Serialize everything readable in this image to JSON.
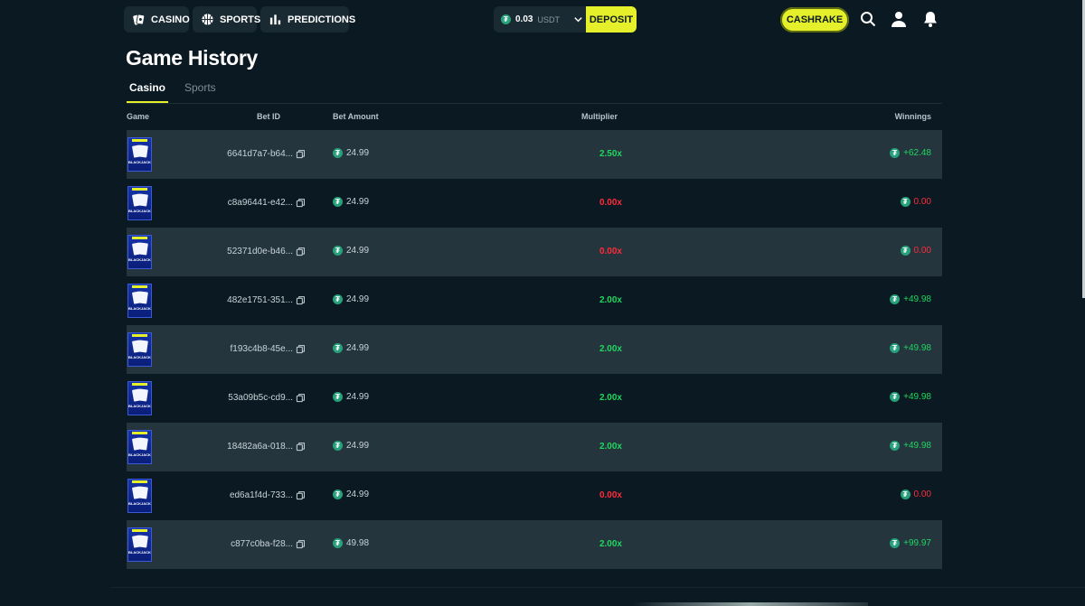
{
  "nav": {
    "casino": "CASINO",
    "sports": "SPORTS",
    "predictions": "PREDICTIONS"
  },
  "wallet": {
    "amount": "0.03",
    "currency": "USDT",
    "deposit": "DEPOSIT"
  },
  "cashrake": "CASHRAKE",
  "page": {
    "title": "Game History",
    "tabs": [
      "Casino",
      "Sports"
    ]
  },
  "table": {
    "headers": {
      "game": "Game",
      "bet_id": "Bet ID",
      "bet_amount": "Bet Amount",
      "multiplier": "Multiplier",
      "winnings": "Winnings"
    },
    "game_name": "BLACKJACK",
    "rows": [
      {
        "bet_id": "6641d7a7-b64...",
        "amount": "24.99",
        "multiplier": "2.50x",
        "winnings": "+62.48",
        "result": "win"
      },
      {
        "bet_id": "c8a96441-e42...",
        "amount": "24.99",
        "multiplier": "0.00x",
        "winnings": "0.00",
        "result": "loss"
      },
      {
        "bet_id": "52371d0e-b46...",
        "amount": "24.99",
        "multiplier": "0.00x",
        "winnings": "0.00",
        "result": "loss"
      },
      {
        "bet_id": "482e1751-351...",
        "amount": "24.99",
        "multiplier": "2.00x",
        "winnings": "+49.98",
        "result": "win"
      },
      {
        "bet_id": "f193c4b8-45e...",
        "amount": "24.99",
        "multiplier": "2.00x",
        "winnings": "+49.98",
        "result": "win"
      },
      {
        "bet_id": "53a09b5c-cd9...",
        "amount": "24.99",
        "multiplier": "2.00x",
        "winnings": "+49.98",
        "result": "win"
      },
      {
        "bet_id": "18482a6a-018...",
        "amount": "24.99",
        "multiplier": "2.00x",
        "winnings": "+49.98",
        "result": "win"
      },
      {
        "bet_id": "ed6a1f4d-733...",
        "amount": "24.99",
        "multiplier": "0.00x",
        "winnings": "0.00",
        "result": "loss"
      },
      {
        "bet_id": "c877c0ba-f28...",
        "amount": "49.98",
        "multiplier": "2.00x",
        "winnings": "+99.97",
        "result": "win"
      }
    ]
  },
  "colors": {
    "accent": "#e6f02a",
    "win": "#1fd65f",
    "loss": "#ff2b3a",
    "background": "#0b1a22",
    "row_alt": "#24353e"
  },
  "icons": {
    "casino": "cards-icon",
    "sports": "basketball-icon",
    "predictions": "bar-chart-icon",
    "coin": "usdt-coin-icon",
    "search": "search-icon",
    "user": "user-icon",
    "notifications": "bell-icon",
    "copy": "copy-icon"
  }
}
